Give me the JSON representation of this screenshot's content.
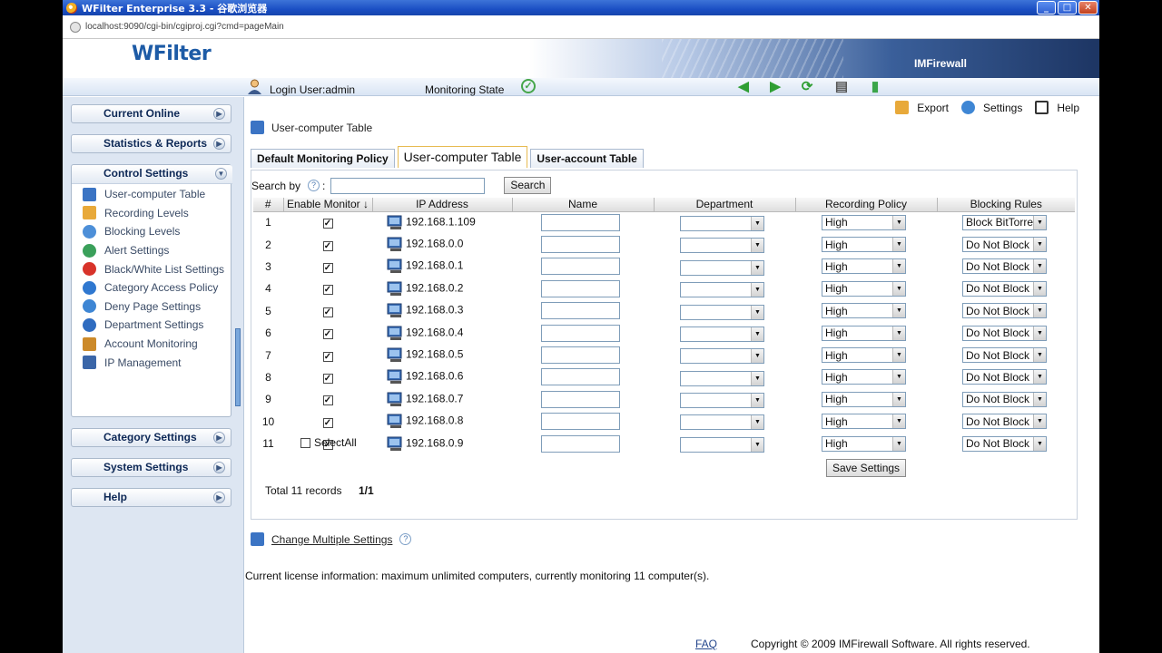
{
  "window": {
    "title": "WFilter Enterprise 3.3 - 谷歌浏览器",
    "min": "_",
    "max": "□",
    "close": "✕"
  },
  "address": {
    "url": "localhost:9090/cgi-bin/cgiproj.cgi?cmd=pageMain"
  },
  "banner": {
    "logo": "WFilter",
    "brand": "IMFirewall"
  },
  "toolbar": {
    "login": "Login User:admin",
    "monitoring_state": "Monitoring State",
    "ok": "✓",
    "back": "◀",
    "forward": "▶",
    "refresh": "⟳",
    "print": "▤",
    "exit": "▮"
  },
  "sidebar": {
    "current_online": "Current Online",
    "stats": "Statistics & Reports",
    "control": "Control Settings",
    "items": [
      {
        "label": "User-computer Table",
        "color": "#3b74c4"
      },
      {
        "label": "Recording Levels",
        "color": "#e8a93a"
      },
      {
        "label": "Blocking Levels",
        "color": "#4d8fd8"
      },
      {
        "label": "Alert Settings",
        "color": "#3aa05a"
      },
      {
        "label": "Black/White List Settings",
        "color": "#d8332a"
      },
      {
        "label": "Category Access Policy",
        "color": "#2f78d0"
      },
      {
        "label": "Deny Page Settings",
        "color": "#3e86d4"
      },
      {
        "label": "Department Settings",
        "color": "#2f6cc0"
      },
      {
        "label": "Account Monitoring",
        "color": "#cc8a2a"
      },
      {
        "label": "IP Management",
        "color": "#3b66a8"
      }
    ],
    "category": "Category Settings",
    "system": "System Settings",
    "help": "Help"
  },
  "topright": {
    "export": "Export",
    "settings": "Settings",
    "help": "Help"
  },
  "breadcrumb": "User-computer Table",
  "tabs": [
    "Default Monitoring Policy",
    "User-computer Table",
    "User-account Table"
  ],
  "search": {
    "label": "Search by",
    "colon": ":",
    "value": "",
    "button": "Search",
    "q": "?"
  },
  "columns": [
    "#",
    "Enable Monitor ↓",
    "IP Address",
    "Name",
    "Department",
    "Recording Policy",
    "Blocking Rules"
  ],
  "rows": [
    {
      "n": "1",
      "ip": "192.168.1.109",
      "name": "",
      "dept": "",
      "rec": "High",
      "block": "Block BitTorre"
    },
    {
      "n": "2",
      "ip": "192.168.0.0",
      "name": "",
      "dept": "",
      "rec": "High",
      "block": "Do Not Block"
    },
    {
      "n": "3",
      "ip": "192.168.0.1",
      "name": "",
      "dept": "",
      "rec": "High",
      "block": "Do Not Block"
    },
    {
      "n": "4",
      "ip": "192.168.0.2",
      "name": "",
      "dept": "",
      "rec": "High",
      "block": "Do Not Block"
    },
    {
      "n": "5",
      "ip": "192.168.0.3",
      "name": "",
      "dept": "",
      "rec": "High",
      "block": "Do Not Block"
    },
    {
      "n": "6",
      "ip": "192.168.0.4",
      "name": "",
      "dept": "",
      "rec": "High",
      "block": "Do Not Block"
    },
    {
      "n": "7",
      "ip": "192.168.0.5",
      "name": "",
      "dept": "",
      "rec": "High",
      "block": "Do Not Block"
    },
    {
      "n": "8",
      "ip": "192.168.0.6",
      "name": "",
      "dept": "",
      "rec": "High",
      "block": "Do Not Block"
    },
    {
      "n": "9",
      "ip": "192.168.0.7",
      "name": "",
      "dept": "",
      "rec": "High",
      "block": "Do Not Block"
    },
    {
      "n": "10",
      "ip": "192.168.0.8",
      "name": "",
      "dept": "",
      "rec": "High",
      "block": "Do Not Block"
    },
    {
      "n": "11",
      "ip": "192.168.0.9",
      "name": "",
      "dept": "",
      "rec": "High",
      "block": "Do Not Block"
    }
  ],
  "select_all": "SelectAll",
  "save": "Save Settings",
  "total": "Total 11 records",
  "pages": "1/1",
  "multi": "Change Multiple Settings",
  "license": "Current license information: maximum unlimited computers, currently monitoring 11 computer(s).",
  "footer": {
    "faq": "FAQ",
    "copyright": "Copyright © 2009  IMFirewall Software. All rights reserved."
  }
}
